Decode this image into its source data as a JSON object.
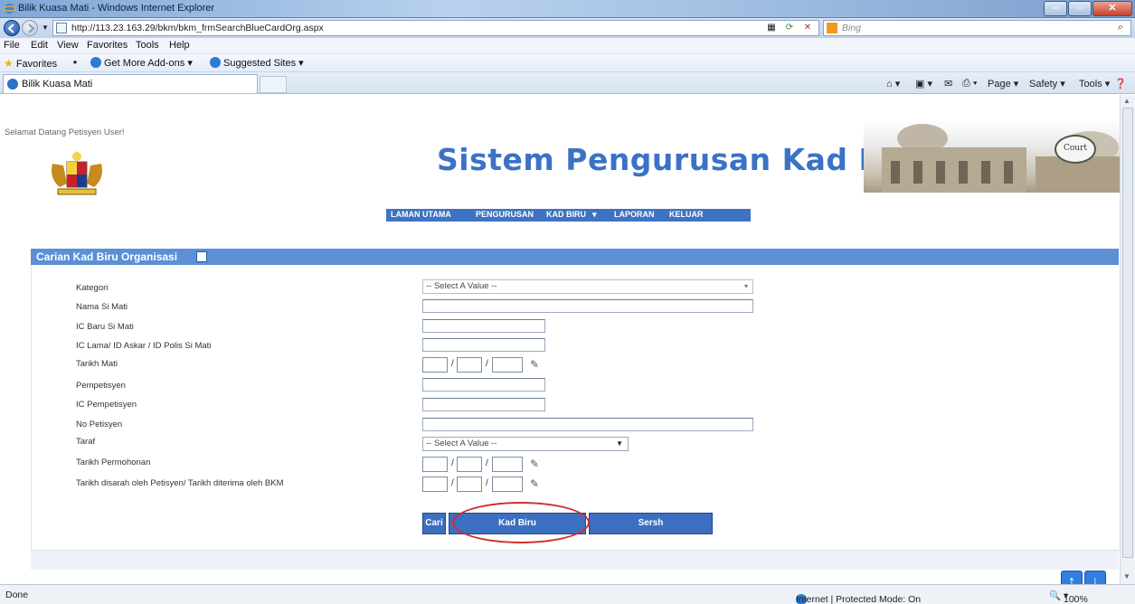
{
  "window": {
    "title": "Bilik Kuasa Mati - Windows Internet Explorer"
  },
  "address": {
    "url": "http://113.23.163.29/bkm/bkm_frmSearchBlueCardOrg.aspx",
    "search_placeholder": "Bing"
  },
  "menu": {
    "items": [
      "File",
      "Edit",
      "View",
      "Favorites",
      "Tools",
      "Help"
    ]
  },
  "favbar": {
    "favorites": "Favorites",
    "addons": "Get More Add-ons ▾",
    "suggested": "Suggested Sites ▾"
  },
  "tab": {
    "title": "Bilik Kuasa Mati"
  },
  "commandbar": {
    "page": "Page ▾",
    "safety": "Safety ▾",
    "tools": "Tools ▾"
  },
  "page": {
    "welcome": "Selamat Datang Petisyen User!",
    "system_title": "Sistem Pengurusan Kad Biru",
    "court_badge": "Court",
    "nav": [
      "LAMAN UTAMA",
      "PENGURUSAN",
      "KAD BIRU",
      "▾",
      "LAPORAN",
      "KELUAR"
    ],
    "panel_title": "Carian Kad Biru Organisasi",
    "fields": {
      "kategori": "Kategori",
      "nama": "Nama Si Mati",
      "ic_baru": "IC Baru Si Mati",
      "ic_lama": "IC Lama/ ID Askar / ID Polis Si Mati",
      "tarikh_mati": "Tarikh Mati",
      "pempetisyen": "Pempetisyen",
      "ic_pempetisyen": "IC Pempetisyen",
      "no_petisyen": "No Petisyen",
      "taraf": "Taraf",
      "tarikh_permohonan": "Tarikh Permohonan",
      "tarikh_diterima": "Tarikh disarah oleh Petisyen/ Tarikh diterima oleh BKM"
    },
    "select_placeholder": "-- Select A Value --",
    "buttons": {
      "cari": "Cari",
      "kad_biru": "Kad Biru",
      "sersh": "Sersh"
    }
  },
  "status": {
    "left": "Done",
    "zone": "Internet | Protected Mode: On",
    "zoom": "100%"
  }
}
